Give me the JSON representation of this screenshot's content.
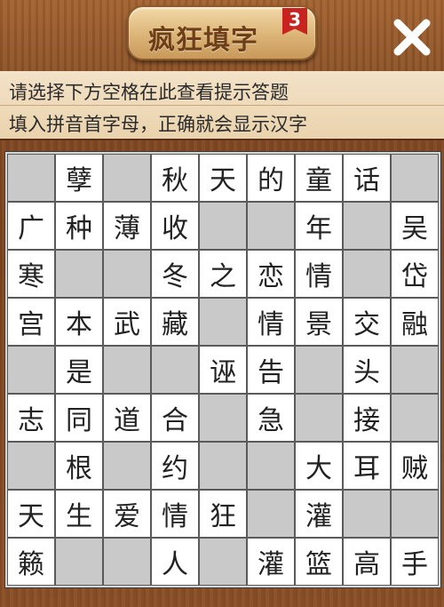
{
  "header": {
    "title": "疯狂填字",
    "level": "3"
  },
  "hint": {
    "line1": "请选择下方空格在此查看提示答题",
    "line2": "填入拼音首字母，正确就会显示汉字"
  },
  "grid": [
    [
      "",
      "孽",
      "",
      "秋",
      "天",
      "的",
      "童",
      "话",
      ""
    ],
    [
      "广",
      "种",
      "薄",
      "收",
      "",
      "",
      "年",
      "",
      "吴"
    ],
    [
      "寒",
      "",
      "",
      "冬",
      "之",
      "恋",
      "情",
      "",
      "岱"
    ],
    [
      "宫",
      "本",
      "武",
      "藏",
      "",
      "情",
      "景",
      "交",
      "融"
    ],
    [
      "",
      "是",
      "",
      "",
      "诬",
      "告",
      "",
      "头",
      ""
    ],
    [
      "志",
      "同",
      "道",
      "合",
      "",
      "急",
      "",
      "接",
      ""
    ],
    [
      "",
      "根",
      "",
      "约",
      "",
      "",
      "大",
      "耳",
      "贼"
    ],
    [
      "天",
      "生",
      "爱",
      "情",
      "狂",
      "",
      "灌",
      "",
      ""
    ],
    [
      "籁",
      "",
      "",
      "人",
      "",
      "灌",
      "篮",
      "高",
      "手"
    ]
  ],
  "blocked": [
    [
      1,
      0,
      1,
      0,
      0,
      0,
      0,
      0,
      1
    ],
    [
      0,
      0,
      0,
      0,
      1,
      1,
      0,
      1,
      0
    ],
    [
      0,
      1,
      1,
      0,
      0,
      0,
      0,
      1,
      0
    ],
    [
      0,
      0,
      0,
      0,
      1,
      0,
      0,
      0,
      0
    ],
    [
      1,
      0,
      1,
      1,
      0,
      0,
      1,
      0,
      1
    ],
    [
      0,
      0,
      0,
      0,
      1,
      0,
      1,
      0,
      1
    ],
    [
      1,
      0,
      1,
      0,
      1,
      1,
      0,
      0,
      0
    ],
    [
      0,
      0,
      0,
      0,
      0,
      1,
      0,
      1,
      1
    ],
    [
      0,
      1,
      1,
      0,
      1,
      0,
      0,
      0,
      0
    ]
  ],
  "colors": {
    "open_cell": "#ffffff",
    "blocked_cell": "#c9c9c9",
    "badge": "#c8231e"
  },
  "icons": {
    "close": "close-icon"
  }
}
